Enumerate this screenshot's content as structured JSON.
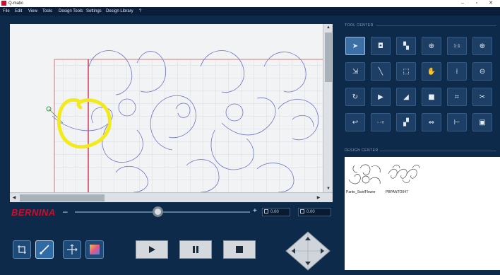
{
  "window": {
    "title": "Q-matic",
    "minimize": "–",
    "maximize": "▫",
    "close": "✕"
  },
  "menu": [
    "File",
    "Edit",
    "View",
    "Tools",
    "Design Tools",
    "Settings",
    "Design Library",
    "?"
  ],
  "brand": "BERNINA",
  "zoom": {
    "minus": "–",
    "plus": "+",
    "level": 0.47
  },
  "readouts": {
    "left": "0.00",
    "right": "0.00"
  },
  "tool_center": {
    "label": "TOOL CENTER",
    "tools": [
      {
        "name": "pointer-icon",
        "sym": "➤"
      },
      {
        "name": "node-box-icon",
        "sym": "◘"
      },
      {
        "name": "layer-stack-icon",
        "sym": "▚"
      },
      {
        "name": "zoom-fit-icon",
        "sym": "⊕"
      },
      {
        "name": "zoom-one-to-one-icon",
        "sym": "1:1"
      },
      {
        "name": "zoom-in-icon",
        "sym": "⊕"
      },
      {
        "name": "resize-box-icon",
        "sym": "⇲"
      },
      {
        "name": "wand-icon",
        "sym": "╲"
      },
      {
        "name": "crop-box-icon",
        "sym": "⬚"
      },
      {
        "name": "hand-pan-icon",
        "sym": "✋"
      },
      {
        "name": "dots-grid-icon",
        "sym": "⁞"
      },
      {
        "name": "zoom-out-icon",
        "sym": "⊖"
      },
      {
        "name": "rotate-icon",
        "sym": "↻"
      },
      {
        "name": "triangle-right-icon",
        "sym": "▶"
      },
      {
        "name": "mirror-icon",
        "sym": "◢"
      },
      {
        "name": "square-fill-icon",
        "sym": "■"
      },
      {
        "name": "corners-icon",
        "sym": "⌗"
      },
      {
        "name": "scissors-icon",
        "sym": "✂"
      },
      {
        "name": "undo-link-icon",
        "sym": "↩"
      },
      {
        "name": "stitch-plus-icon",
        "sym": "⋯+"
      },
      {
        "name": "blocks-icon",
        "sym": "▞"
      },
      {
        "name": "link-box-icon",
        "sym": "⇔"
      },
      {
        "name": "align-left-icon",
        "sym": "⊢"
      },
      {
        "name": "image-frame-icon",
        "sym": "▣"
      }
    ]
  },
  "design_center": {
    "label": "DESIGN CENTER",
    "items": [
      {
        "name": "Panto_SwirlFlower"
      },
      {
        "name": "PBPANTO047"
      }
    ]
  },
  "colors": {
    "accent_red": "#c8102e",
    "highlight_yellow": "#f2ea1a",
    "stitch_blue": "#6b74c9",
    "grid": "#c7cdd3"
  }
}
